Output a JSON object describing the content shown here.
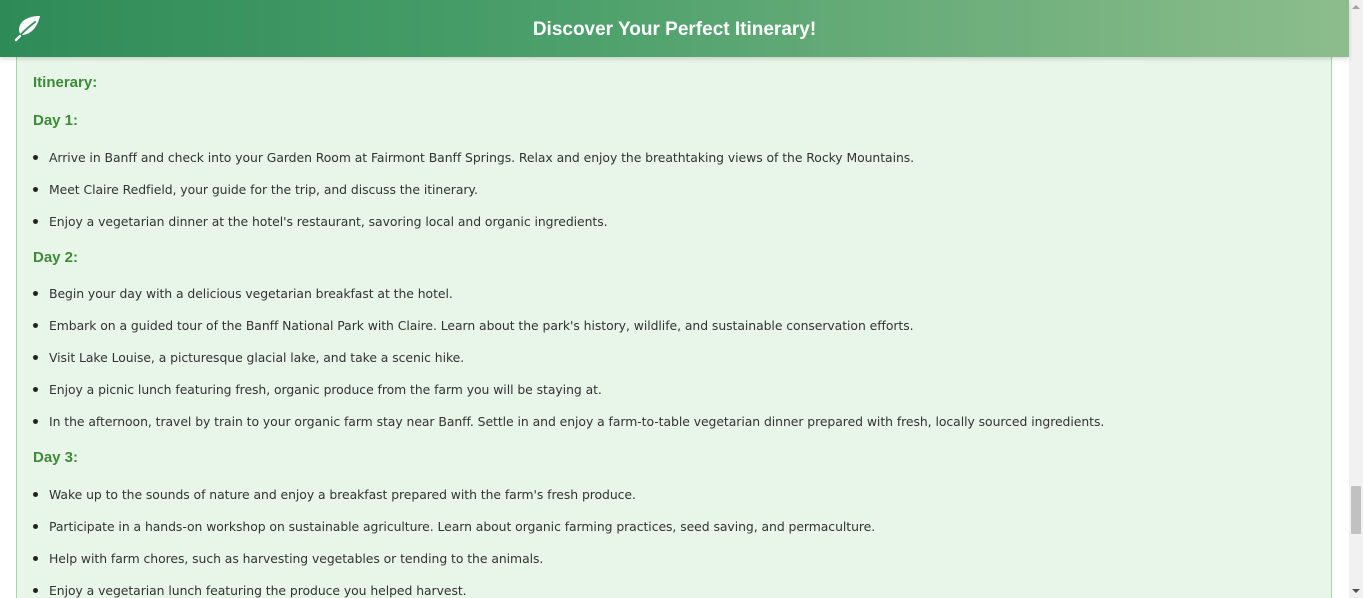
{
  "header": {
    "title": "Discover Your Perfect Itinerary!",
    "logo_icon": "leaf-icon"
  },
  "itinerary": {
    "heading": "Itinerary:",
    "days": [
      {
        "label": "Day 1:",
        "items": [
          "Arrive in Banff and check into your Garden Room at Fairmont Banff Springs. Relax and enjoy the breathtaking views of the Rocky Mountains.",
          "Meet Claire Redfield, your guide for the trip, and discuss the itinerary.",
          "Enjoy a vegetarian dinner at the hotel's restaurant, savoring local and organic ingredients."
        ]
      },
      {
        "label": "Day 2:",
        "items": [
          "Begin your day with a delicious vegetarian breakfast at the hotel.",
          "Embark on a guided tour of the Banff National Park with Claire. Learn about the park's history, wildlife, and sustainable conservation efforts.",
          "Visit Lake Louise, a picturesque glacial lake, and take a scenic hike.",
          "Enjoy a picnic lunch featuring fresh, organic produce from the farm you will be staying at.",
          "In the afternoon, travel by train to your organic farm stay near Banff. Settle in and enjoy a farm-to-table vegetarian dinner prepared with fresh, locally sourced ingredients."
        ]
      },
      {
        "label": "Day 3:",
        "items": [
          "Wake up to the sounds of nature and enjoy a breakfast prepared with the farm's fresh produce.",
          "Participate in a hands-on workshop on sustainable agriculture. Learn about organic farming practices, seed saving, and permaculture.",
          "Help with farm chores, such as harvesting vegetables or tending to the animals.",
          "Enjoy a vegetarian lunch featuring the produce you helped harvest."
        ]
      }
    ]
  },
  "colors": {
    "header_gradient_start": "#2e8b57",
    "header_gradient_end": "#8dbd8c",
    "heading_green": "#3d8b37",
    "content_bg": "#e8f5e9"
  }
}
